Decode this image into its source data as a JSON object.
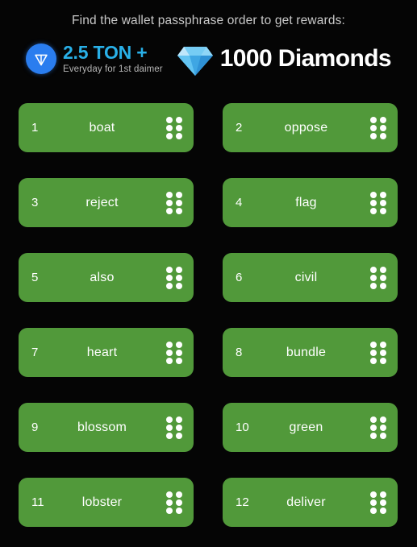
{
  "header": {
    "headline": "Find the wallet passphrase order to get rewards:",
    "ton_promo": {
      "icon": "ton-logo-icon",
      "amount": "2.5 TON +",
      "subtitle": "Everyday for 1st daimer",
      "accent_color": "#29b0e8",
      "badge_color": "#2a7def"
    },
    "diamond_promo": {
      "icon": "diamond-gem-icon",
      "amount": "1000 Diamonds",
      "gem_color": "#5bc8f5"
    }
  },
  "colors": {
    "background": "#050505",
    "card_green": "#51993a",
    "card_text": "#ffffff",
    "headline_text": "#c9c9c9"
  },
  "word_cards": [
    {
      "index": "1",
      "word": "boat",
      "handle": "drag-handle-icon"
    },
    {
      "index": "2",
      "word": "oppose",
      "handle": "drag-handle-icon"
    },
    {
      "index": "3",
      "word": "reject",
      "handle": "drag-handle-icon"
    },
    {
      "index": "4",
      "word": "flag",
      "handle": "drag-handle-icon"
    },
    {
      "index": "5",
      "word": "also",
      "handle": "drag-handle-icon"
    },
    {
      "index": "6",
      "word": "civil",
      "handle": "drag-handle-icon"
    },
    {
      "index": "7",
      "word": "heart",
      "handle": "drag-handle-icon"
    },
    {
      "index": "8",
      "word": "bundle",
      "handle": "drag-handle-icon"
    },
    {
      "index": "9",
      "word": "blossom",
      "handle": "drag-handle-icon"
    },
    {
      "index": "10",
      "word": "green",
      "handle": "drag-handle-icon"
    },
    {
      "index": "11",
      "word": "lobster",
      "handle": "drag-handle-icon"
    },
    {
      "index": "12",
      "word": "deliver",
      "handle": "drag-handle-icon"
    }
  ]
}
